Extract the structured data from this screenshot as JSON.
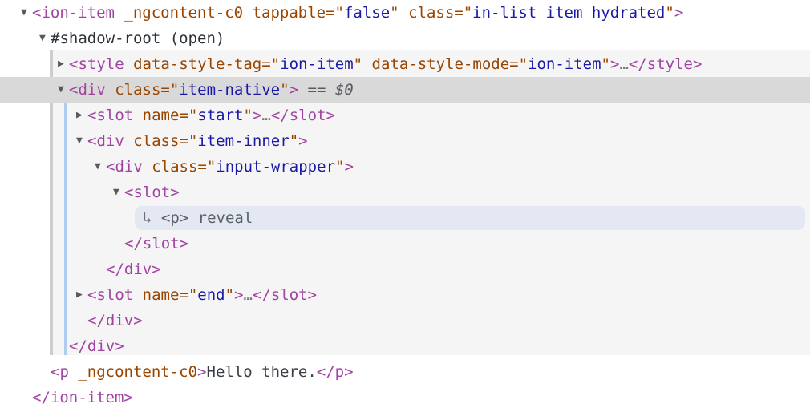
{
  "panel": {
    "name": "dom-tree-inspector",
    "background": "#ffffff",
    "shadow_background": "#f5f5f5",
    "selected_row_background": "#d9d9d9",
    "text_node_highlight": "#e3e8f2",
    "guide_line_color": "#aecbf0"
  },
  "colors": {
    "tag": "#a144a1",
    "attribute": "#994500",
    "value": "#1a1aa6",
    "selection_marker": "#5a5a60",
    "plain_text": "#3a3f45"
  },
  "rows": [
    {
      "id": "row-ion-item-open",
      "twisty": "▼",
      "depth": 0,
      "selected": false,
      "tokens": [
        {
          "t": "tag",
          "v": "<ion-item"
        },
        {
          "t": "space",
          "v": " "
        },
        {
          "t": "attr",
          "v": "_ngcontent-c0"
        },
        {
          "t": "space",
          "v": " "
        },
        {
          "t": "attr",
          "v": "tappable=\""
        },
        {
          "t": "val",
          "v": "false"
        },
        {
          "t": "attr",
          "v": "\""
        },
        {
          "t": "space",
          "v": " "
        },
        {
          "t": "attr",
          "v": "class=\""
        },
        {
          "t": "val",
          "v": "in-list item hydrated"
        },
        {
          "t": "attr",
          "v": "\""
        },
        {
          "t": "tag",
          "v": ">"
        }
      ]
    },
    {
      "id": "row-shadow-root",
      "twisty": "▼",
      "depth": 1,
      "selected": false,
      "tokens": [
        {
          "t": "shadow",
          "v": "#shadow-root (open)"
        }
      ]
    },
    {
      "id": "row-style",
      "twisty": "▶",
      "depth": 2,
      "selected": false,
      "tokens": [
        {
          "t": "tag",
          "v": "<style"
        },
        {
          "t": "space",
          "v": " "
        },
        {
          "t": "attr",
          "v": "data-style-tag=\""
        },
        {
          "t": "val",
          "v": "ion-item"
        },
        {
          "t": "attr",
          "v": "\""
        },
        {
          "t": "space",
          "v": " "
        },
        {
          "t": "attr",
          "v": "data-style-mode=\""
        },
        {
          "t": "val",
          "v": "ion-item"
        },
        {
          "t": "attr",
          "v": "\""
        },
        {
          "t": "tag",
          "v": ">"
        },
        {
          "t": "ellipsis",
          "v": "…"
        },
        {
          "t": "tag",
          "v": "</style>"
        }
      ]
    },
    {
      "id": "row-item-native",
      "twisty": "▼",
      "depth": 2,
      "selected": true,
      "tokens": [
        {
          "t": "tag",
          "v": "<div"
        },
        {
          "t": "space",
          "v": " "
        },
        {
          "t": "attr",
          "v": "class=\""
        },
        {
          "t": "val",
          "v": "item-native"
        },
        {
          "t": "attr",
          "v": "\""
        },
        {
          "t": "tag",
          "v": ">"
        },
        {
          "t": "space",
          "v": " "
        },
        {
          "t": "sel",
          "v": "== $0"
        }
      ]
    },
    {
      "id": "row-slot-start",
      "twisty": "▶",
      "depth": 3,
      "selected": false,
      "tokens": [
        {
          "t": "tag",
          "v": "<slot"
        },
        {
          "t": "space",
          "v": " "
        },
        {
          "t": "attr",
          "v": "name=\""
        },
        {
          "t": "val",
          "v": "start"
        },
        {
          "t": "attr",
          "v": "\""
        },
        {
          "t": "tag",
          "v": ">"
        },
        {
          "t": "ellipsis",
          "v": "…"
        },
        {
          "t": "tag",
          "v": "</slot>"
        }
      ]
    },
    {
      "id": "row-item-inner",
      "twisty": "▼",
      "depth": 3,
      "selected": false,
      "tokens": [
        {
          "t": "tag",
          "v": "<div"
        },
        {
          "t": "space",
          "v": " "
        },
        {
          "t": "attr",
          "v": "class=\""
        },
        {
          "t": "val",
          "v": "item-inner"
        },
        {
          "t": "attr",
          "v": "\""
        },
        {
          "t": "tag",
          "v": ">"
        }
      ]
    },
    {
      "id": "row-input-wrapper",
      "twisty": "▼",
      "depth": 4,
      "selected": false,
      "tokens": [
        {
          "t": "tag",
          "v": "<div"
        },
        {
          "t": "space",
          "v": " "
        },
        {
          "t": "attr",
          "v": "class=\""
        },
        {
          "t": "val",
          "v": "input-wrapper"
        },
        {
          "t": "attr",
          "v": "\""
        },
        {
          "t": "tag",
          "v": ">"
        }
      ]
    },
    {
      "id": "row-slot-open",
      "twisty": "▼",
      "depth": 5,
      "selected": false,
      "tokens": [
        {
          "t": "tag",
          "v": "<slot>"
        }
      ]
    },
    {
      "id": "row-reveal-text-node",
      "twisty": "",
      "depth": 6,
      "selected": false,
      "pill": true,
      "tokens": [
        {
          "t": "arrow-in",
          "v": "↳ "
        },
        {
          "t": "nodetext",
          "v": "<p> reveal"
        }
      ]
    },
    {
      "id": "row-slot-close",
      "twisty": "",
      "depth": 5,
      "selected": false,
      "tokens": [
        {
          "t": "tag",
          "v": "</slot>"
        }
      ]
    },
    {
      "id": "row-input-wrapper-close",
      "twisty": "",
      "depth": 4,
      "selected": false,
      "tokens": [
        {
          "t": "tag",
          "v": "</div>"
        }
      ]
    },
    {
      "id": "row-slot-end",
      "twisty": "▶",
      "depth": 3,
      "selected": false,
      "tokens": [
        {
          "t": "tag",
          "v": "<slot"
        },
        {
          "t": "space",
          "v": " "
        },
        {
          "t": "attr",
          "v": "name=\""
        },
        {
          "t": "val",
          "v": "end"
        },
        {
          "t": "attr",
          "v": "\""
        },
        {
          "t": "tag",
          "v": ">"
        },
        {
          "t": "ellipsis",
          "v": "…"
        },
        {
          "t": "tag",
          "v": "</slot>"
        }
      ]
    },
    {
      "id": "row-item-inner-close",
      "twisty": "",
      "depth": 3,
      "selected": false,
      "tokens": [
        {
          "t": "tag",
          "v": "</div>"
        }
      ]
    },
    {
      "id": "row-item-native-close",
      "twisty": "",
      "depth": 2,
      "selected": false,
      "tokens": [
        {
          "t": "tag",
          "v": "</div>"
        }
      ]
    },
    {
      "id": "row-p-hello",
      "twisty": "",
      "depth": 1,
      "selected": false,
      "tokens": [
        {
          "t": "tag",
          "v": "<p"
        },
        {
          "t": "space",
          "v": " "
        },
        {
          "t": "attr",
          "v": "_ngcontent-c0"
        },
        {
          "t": "tag",
          "v": ">"
        },
        {
          "t": "text",
          "v": "Hello there."
        },
        {
          "t": "tag",
          "v": "</p>"
        }
      ]
    },
    {
      "id": "row-ion-item-close",
      "twisty": "",
      "depth": 0,
      "selected": false,
      "tokens": [
        {
          "t": "tag",
          "v": "</ion-item>"
        }
      ]
    }
  ]
}
